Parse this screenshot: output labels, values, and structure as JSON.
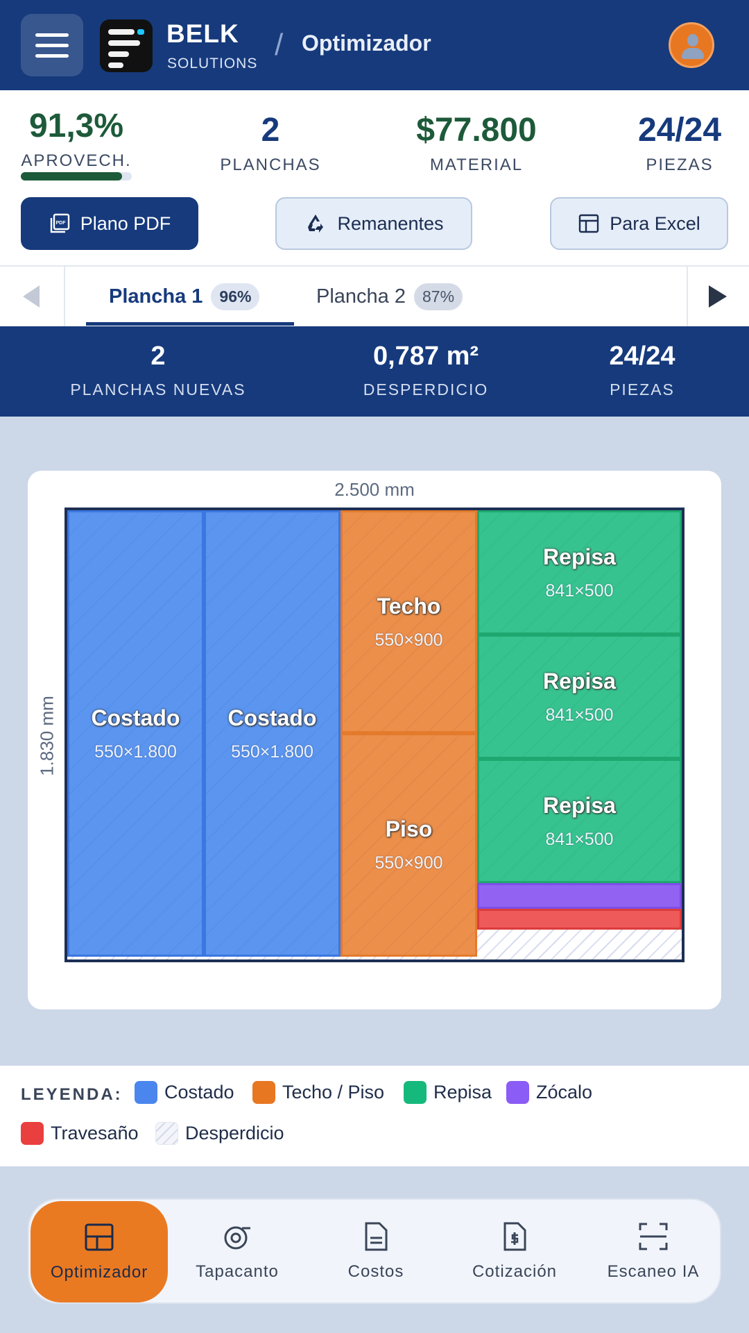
{
  "header": {
    "brand_name": "BELK",
    "brand_sub": "SOLUTIONS",
    "separator": "/",
    "page_title": "Optimizador",
    "colors": {
      "primary": "#163a7c",
      "accent": "#e87722"
    }
  },
  "stats": [
    {
      "value": "91,3%",
      "label": "APROVECH.",
      "color": "#1d5a3a"
    },
    {
      "value": "2",
      "label": "PLANCHAS",
      "color": "#163a7c"
    },
    {
      "value": "$77.800",
      "label": "MATERIAL",
      "color": "#1d5a3a"
    },
    {
      "value": "24/24",
      "label": "PIEZAS",
      "color": "#163a7c"
    }
  ],
  "utilization_progress": 0.913,
  "actions": {
    "pdf_label": "Plano PDF",
    "remnants_label": "Remanentes",
    "excel_label": "Para Excel"
  },
  "tabs": [
    {
      "label": "Plancha 1",
      "badge": "96%",
      "active": true
    },
    {
      "label": "Plancha 2",
      "badge": "87%",
      "active": false
    }
  ],
  "summary": [
    {
      "value": "2",
      "label": "PLANCHAS NUEVAS"
    },
    {
      "value": "0,787 m²",
      "label": "DESPERDICIO"
    },
    {
      "value": "24/24",
      "label": "PIEZAS"
    }
  ],
  "board": {
    "width_label": "2.500 mm",
    "height_label": "1.830 mm",
    "pieces": [
      {
        "name": "Costado",
        "size": "550×1.800"
      },
      {
        "name": "Costado",
        "size": "550×1.800"
      },
      {
        "name": "Techo",
        "size": "550×900"
      },
      {
        "name": "Piso",
        "size": "550×900"
      },
      {
        "name": "Repisa",
        "size": "841×500"
      },
      {
        "name": "Repisa",
        "size": "841×500"
      },
      {
        "name": "Repisa",
        "size": "841×500"
      }
    ]
  },
  "legend": {
    "title": "LEYENDA:",
    "items": [
      {
        "label": "Costado",
        "color": "#4a86ee"
      },
      {
        "label": "Techo / Piso",
        "color": "#e87722"
      },
      {
        "label": "Repisa",
        "color": "#16b97c"
      },
      {
        "label": "Zócalo",
        "color": "#8b5cf6"
      },
      {
        "label": "Travesaño",
        "color": "#ea3f3f"
      },
      {
        "label": "Desperdicio",
        "color": "#d4d9ea"
      }
    ]
  },
  "bottom_nav": [
    {
      "label": "Optimizador",
      "icon": "layout-icon",
      "active": true
    },
    {
      "label": "Tapacanto",
      "icon": "tape-icon",
      "active": false
    },
    {
      "label": "Costos",
      "icon": "document-icon",
      "active": false
    },
    {
      "label": "Cotización",
      "icon": "invoice-icon",
      "active": false
    },
    {
      "label": "Escaneo IA",
      "icon": "scan-icon",
      "active": false
    }
  ]
}
